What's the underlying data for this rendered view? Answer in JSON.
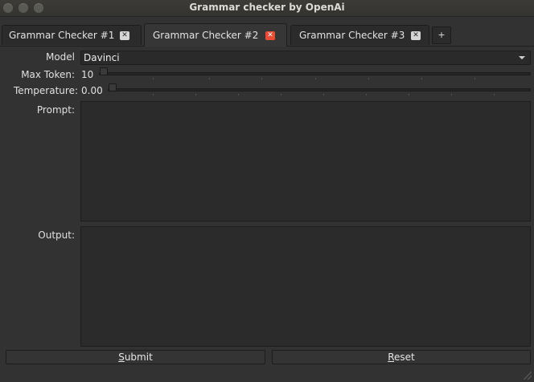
{
  "window": {
    "title": "Grammar checker by OpenAi"
  },
  "tabs": [
    {
      "label": "Grammar Checker #1",
      "active": false
    },
    {
      "label": "Grammar Checker #2",
      "active": true
    },
    {
      "label": "Grammar Checker #3",
      "active": false
    }
  ],
  "tab_add_label": "+",
  "form": {
    "model_label": "Model",
    "model_value": "Davinci",
    "max_token_label": "Max Token:",
    "max_token_value": "10",
    "temperature_label": "Temperature:",
    "temperature_value": "0.00",
    "prompt_label": "Prompt:",
    "output_label": "Output:",
    "prompt_text": "",
    "output_text": ""
  },
  "buttons": {
    "submit_mnemonic": "S",
    "submit_rest": "ubmit",
    "reset_mnemonic": "R",
    "reset_rest": "eset"
  },
  "colors": {
    "background": "#323232",
    "active_close": "#e94b35",
    "inactive_close": "#d6d6d6"
  }
}
